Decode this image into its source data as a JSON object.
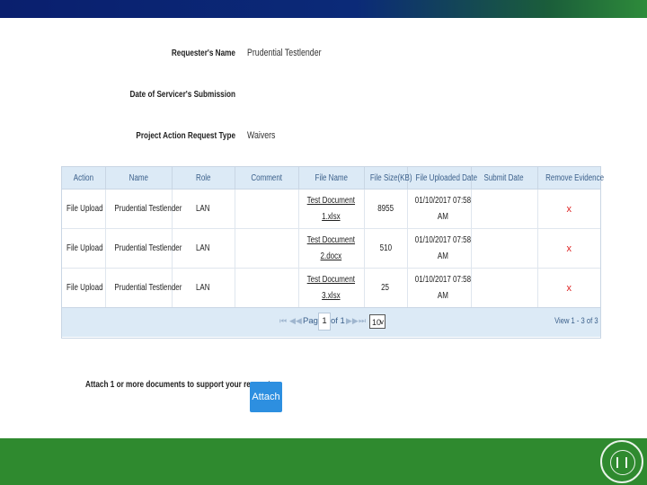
{
  "header": {
    "watermark": ""
  },
  "form": {
    "requester_label": "Requester's Name",
    "requester_value": "Prudential Testlender",
    "submission_label": "Date of Servicer's Submission",
    "submission_value": "",
    "type_label": "Project Action Request Type",
    "type_value": "Waivers"
  },
  "grid": {
    "columns": [
      "Action",
      "Name",
      "Role",
      "Comment",
      "File Name",
      "File Size(KB)",
      "File Uploaded Date",
      "Submit Date",
      "Remove Evidence"
    ],
    "rows": [
      {
        "action": "File Upload",
        "name": "Prudential Testlender",
        "role": "LAN",
        "comment": "",
        "file_line1": "Test Document",
        "file_line2": "1.xlsx",
        "size": "8955",
        "uploaded_line1": "01/10/2017 07:58",
        "uploaded_line2": "AM",
        "submit": "",
        "remove": "x"
      },
      {
        "action": "File Upload",
        "name": "Prudential Testlender",
        "role": "LAN",
        "comment": "",
        "file_line1": "Test Document",
        "file_line2": "2.docx",
        "size": "510",
        "uploaded_line1": "01/10/2017 07:58",
        "uploaded_line2": "AM",
        "submit": "",
        "remove": "x"
      },
      {
        "action": "File Upload",
        "name": "Prudential Testlender",
        "role": "LAN",
        "comment": "",
        "file_line1": "Test Document",
        "file_line2": "3.xlsx",
        "size": "25",
        "uploaded_line1": "01/10/2017 07:58",
        "uploaded_line2": "AM",
        "submit": "",
        "remove": "x"
      }
    ],
    "pager": {
      "first_icon": "first-page-icon",
      "prev_icon": "prev-page-icon",
      "next_icon": "next-page-icon",
      "last_icon": "last-page-icon",
      "page_label": "Page",
      "page_value": "1",
      "of_label": "of 1",
      "rows_value": "10",
      "view_text": "View 1 - 3 of 3"
    }
  },
  "attach": {
    "label": "Attach 1 or more documents to support your request",
    "button": "Attach"
  }
}
